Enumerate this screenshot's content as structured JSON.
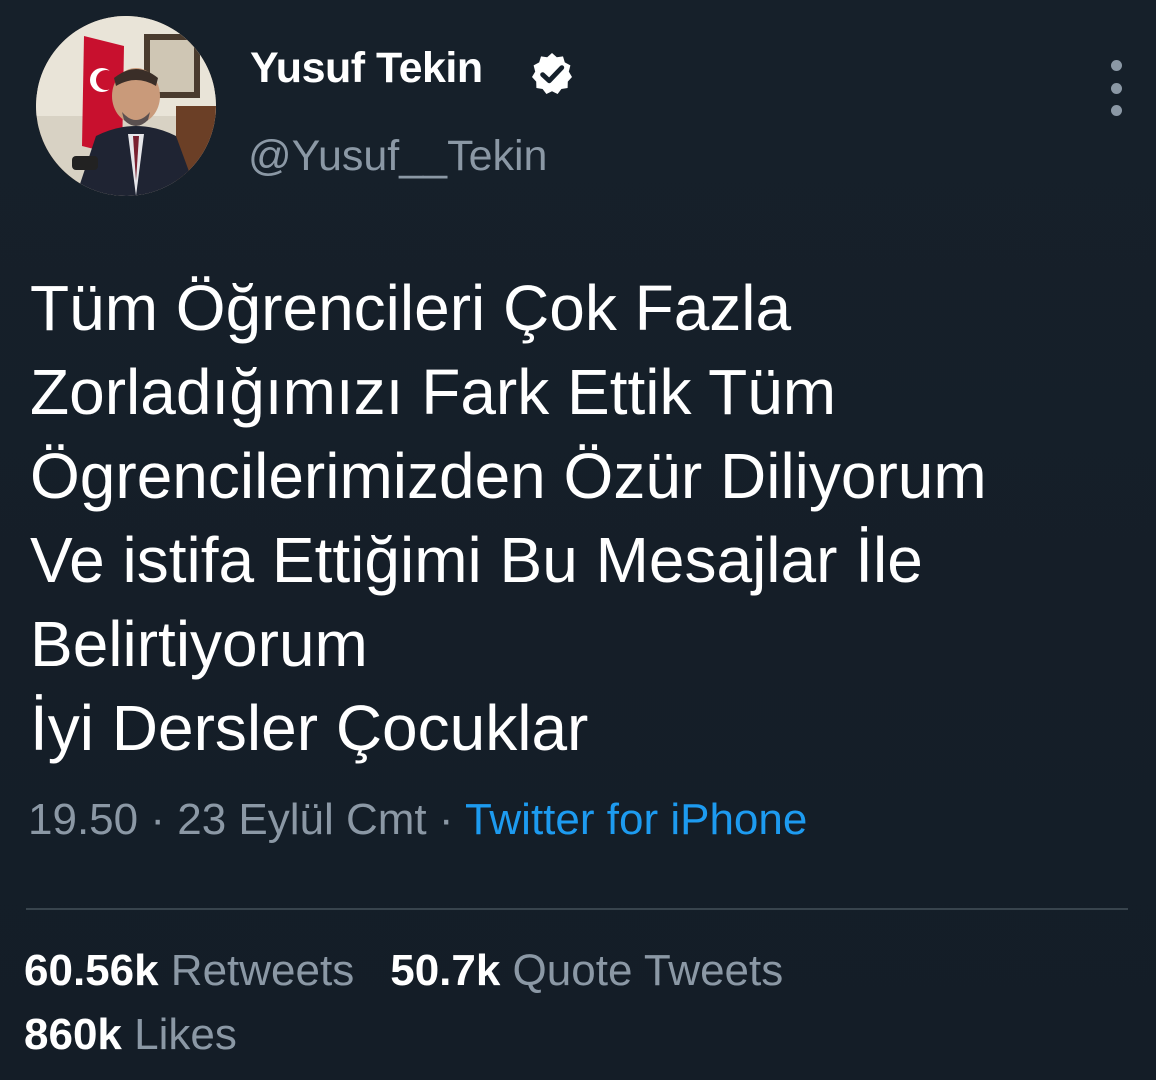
{
  "profile": {
    "display_name": "Yusuf Tekin",
    "handle": "@Yusuf__Tekin",
    "avatar_icon": "profile-photo",
    "verified_icon": "verified-badge-icon"
  },
  "tweet": {
    "lines": [
      "Tüm Öğrencileri Çok Fazla",
      "Zorladığımızı Fark Ettik Tüm",
      "Ögrencilerimizden Özür Diliyorum",
      "Ve istifa Ettiğimi Bu Mesajlar İle",
      "Belirtiyorum",
      "İyi Dersler Çocuklar"
    ]
  },
  "meta": {
    "time": "19.50",
    "separator": " · ",
    "date": "23 Eylül Cmt",
    "source": "Twitter for iPhone"
  },
  "stats": {
    "retweets_count": "60.56k",
    "retweets_label": " Retweets",
    "quotes_count": "50.7k",
    "quotes_label": " Quote Tweets",
    "likes_count": "860k",
    "likes_label": " Likes"
  },
  "colors": {
    "background": "#15202b",
    "secondary_text": "#8b98a5",
    "link": "#1d9bf0"
  }
}
